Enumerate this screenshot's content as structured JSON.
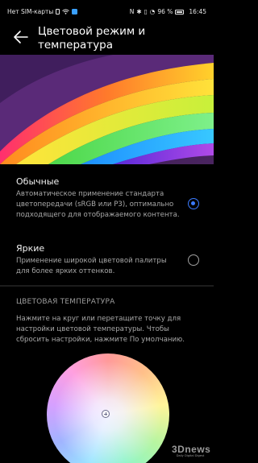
{
  "status_bar": {
    "carrier": "Нет SIM-карты",
    "battery": "96 %",
    "time": "16:45",
    "left_icons": [
      "sim-icon",
      "wifi-icon",
      "notification-icon"
    ],
    "right_icons": [
      "nfc-icon",
      "bluetooth-icon",
      "vibrate-icon",
      "alarm-icon",
      "battery-icon"
    ]
  },
  "app_bar": {
    "back_icon": "arrow-left-icon",
    "title": "Цветовой режим и температура"
  },
  "modes": [
    {
      "title": "Обычные",
      "description": "Автоматическое применение стандарта цветопередачи (sRGB или P3), оптимально подходящего для отображаемого контента.",
      "selected": true
    },
    {
      "title": "Яркие",
      "description": "Применение широкой цветовой палитры для более ярких оттенков.",
      "selected": false
    }
  ],
  "temperature": {
    "header": "ЦВЕТОВАЯ ТЕМПЕРАТУРА",
    "description": "Нажмите на круг или перетащите точку для настройки цветовой температуры. Чтобы сбросить настройки, нажмите По умолчанию."
  },
  "watermark": {
    "logo": "3Dnews",
    "subtitle": "Daily Digital Digest"
  },
  "colors": {
    "accent": "#3b7bff",
    "background": "#000000",
    "secondary_text": "#a8a8a8"
  }
}
